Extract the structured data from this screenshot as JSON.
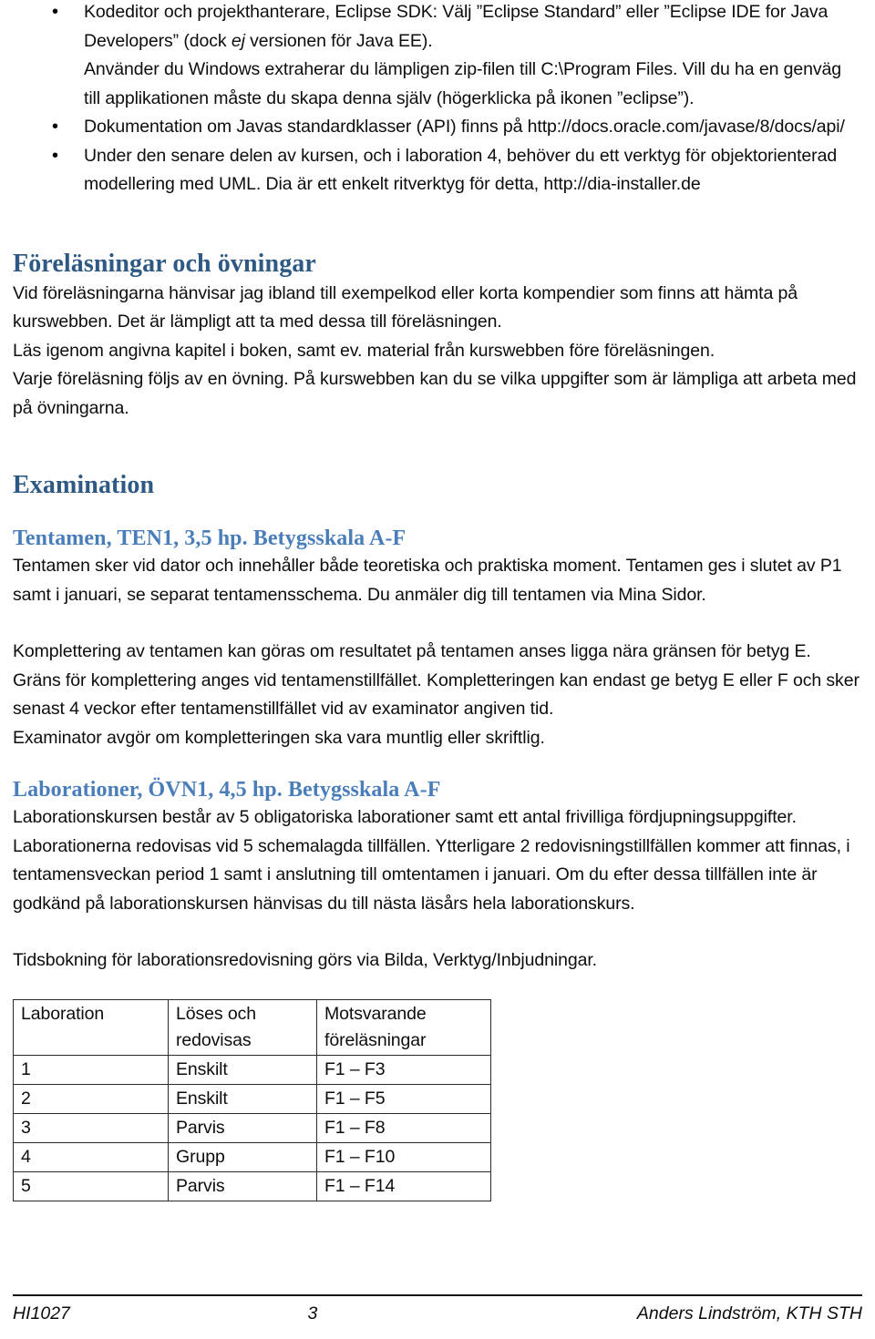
{
  "document": {
    "page_number": "3",
    "course_code": "HI1027",
    "author": "Anders Lindström, KTH STH"
  },
  "bullets": [
    {
      "text": "Kodeditor och projekthanterare, Eclipse SDK: Välj ”Eclipse Standard” eller ”Eclipse IDE for Java Developers” (dock ",
      "italic_word": "ej",
      "text_after": " versionen för Java EE).",
      "sub": "Använder du Windows extraherar du lämpligen zip-filen till C:\\Program Files. Vill du ha en genväg till applikationen måste du skapa denna själv (högerklicka på ikonen ”eclipse”)."
    },
    {
      "text": "Dokumentation om Javas standardklasser (API) finns på http://docs.oracle.com/javase/8/docs/api/"
    },
    {
      "text": "Under den senare delen av kursen, och i laboration 4, behöver du ett verktyg för objektorienterad modellering med UML. Dia är ett enkelt ritverktyg för detta, http://dia-installer.de"
    }
  ],
  "sections": {
    "lectures": {
      "heading": "Föreläsningar och övningar",
      "paragraphs": [
        "Vid föreläsningarna hänvisar jag ibland till exempelkod eller korta kompendier som finns att hämta på kurswebben. Det är lämpligt att ta med dessa till föreläsningen.",
        "Läs igenom angivna kapitel i boken, samt ev. material från kurswebben före föreläsningen.",
        "Varje föreläsning följs av en övning. På kurswebben kan du se vilka uppgifter som är lämpliga att arbeta med på övningarna."
      ]
    },
    "examination": {
      "heading": "Examination",
      "exam": {
        "subheading": "Tentamen, TEN1, 3,5 hp. Betygsskala A-F",
        "paragraphs": [
          "Tentamen sker vid dator och innehåller både teoretiska och praktiska moment. Tentamen ges i slutet av P1 samt i januari, se separat tentamensschema. Du anmäler dig till tentamen via Mina Sidor.",
          "Komplettering av tentamen kan göras om resultatet på tentamen anses ligga nära gränsen för betyg E. Gräns för komplettering anges vid tentamenstillfället. Kompletteringen kan endast ge betyg E eller F och sker senast 4 veckor efter tentamenstillfället vid av examinator angiven tid.",
          "Examinator avgör om kompletteringen ska vara muntlig eller skriftlig."
        ]
      },
      "labs": {
        "subheading": "Laborationer, ÖVN1, 4,5 hp. Betygsskala A-F",
        "paragraphs": [
          "Laborationskursen består av 5 obligatoriska laborationer samt ett antal frivilliga fördjupningsuppgifter.",
          "Laborationerna redovisas vid 5 schemalagda tillfällen. Ytterligare 2 redovisningstillfällen kommer att finnas, i tentamensveckan period 1 samt i anslutning till omtentamen i januari. Om du efter dessa tillfällen inte är godkänd på laborationskursen hänvisas du till nästa läsårs hela laborationskurs.",
          "Tidsbokning för laborationsredovisning görs via Bilda, Verktyg/Inbjudningar."
        ]
      }
    }
  },
  "lab_table": {
    "headers": [
      "Laboration",
      "Löses och redovisas",
      "Motsvarande föreläsningar"
    ],
    "header_lines": [
      [
        "Laboration",
        ""
      ],
      [
        "Löses och",
        "redovisas"
      ],
      [
        "Motsvarande",
        "föreläsningar"
      ]
    ],
    "rows": [
      [
        "1",
        "Enskilt",
        "F1 – F3"
      ],
      [
        "2",
        "Enskilt",
        "F1 – F5"
      ],
      [
        "3",
        "Parvis",
        "F1 – F8"
      ],
      [
        "4",
        "Grupp",
        "F1 – F10"
      ],
      [
        "5",
        "Parvis",
        "F1 – F14"
      ]
    ]
  },
  "colors": {
    "heading_dark_blue": "#2e5984",
    "heading_light_blue": "#4a7ebb",
    "body_text": "#0d0d0d",
    "table_border": "#2b2b2b"
  }
}
